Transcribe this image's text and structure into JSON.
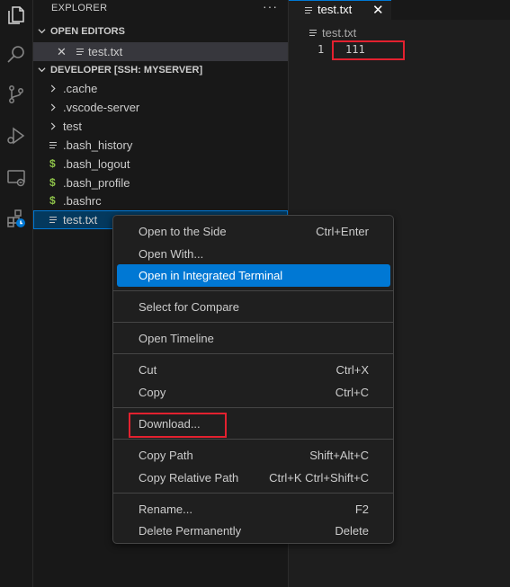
{
  "sidebar": {
    "title": "EXPLORER",
    "more": "···",
    "open_editors": {
      "header": "OPEN EDITORS",
      "items": [
        {
          "close": "✕",
          "label": "test.txt"
        }
      ]
    },
    "workspace": {
      "header": "DEVELOPER [SSH: MYSERVER]",
      "folders": [
        ".cache",
        ".vscode-server",
        "test"
      ],
      "files": [
        {
          "label": ".bash_history",
          "icon": "lines"
        },
        {
          "label": ".bash_logout",
          "icon": "$"
        },
        {
          "label": ".bash_profile",
          "icon": "$"
        },
        {
          "label": ".bashrc",
          "icon": "$"
        },
        {
          "label": "test.txt",
          "icon": "lines"
        }
      ]
    }
  },
  "editor": {
    "tab": {
      "label": "test.txt",
      "close": "✕"
    },
    "breadcrumb": "test.txt",
    "line_number": "1",
    "line_text": "111"
  },
  "context_menu": {
    "items": [
      {
        "label": "Open to the Side",
        "shortcut": "Ctrl+Enter"
      },
      {
        "label": "Open With...",
        "shortcut": ""
      },
      {
        "label": "Open in Integrated Terminal",
        "shortcut": ""
      },
      {
        "label": "Select for Compare",
        "shortcut": ""
      },
      {
        "label": "Open Timeline",
        "shortcut": ""
      },
      {
        "label": "Cut",
        "shortcut": "Ctrl+X"
      },
      {
        "label": "Copy",
        "shortcut": "Ctrl+C"
      },
      {
        "label": "Download...",
        "shortcut": ""
      },
      {
        "label": "Copy Path",
        "shortcut": "Shift+Alt+C"
      },
      {
        "label": "Copy Relative Path",
        "shortcut": "Ctrl+K Ctrl+Shift+C"
      },
      {
        "label": "Rename...",
        "shortcut": "F2"
      },
      {
        "label": "Delete Permanently",
        "shortcut": "Delete"
      }
    ]
  },
  "colors": {
    "accent": "#0078d4",
    "highlight_box": "#e3212f",
    "shell_icon": "#8dc149"
  },
  "activity_icons": [
    "explorer-icon",
    "search-icon",
    "source-control-icon",
    "run-debug-icon",
    "remote-explorer-icon",
    "extensions-icon"
  ]
}
